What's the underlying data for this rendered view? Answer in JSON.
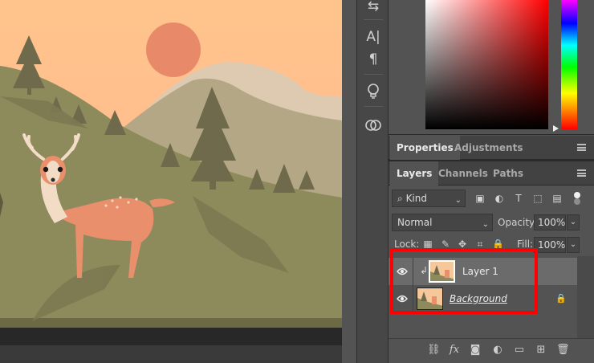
{
  "tools": {
    "items": [
      {
        "name": "character-tool-icon",
        "glyph": "A|"
      },
      {
        "name": "paragraph-tool-icon",
        "glyph": "¶"
      },
      {
        "name": "lightbulb-icon",
        "glyph": "💡"
      },
      {
        "name": "cloud-libraries-icon",
        "glyph": "☁"
      }
    ]
  },
  "properties_tabs": {
    "properties": "Properties",
    "adjustments": "Adjustments"
  },
  "layers_tabs": {
    "layers": "Layers",
    "channels": "Channels",
    "paths": "Paths"
  },
  "filter": {
    "kind_label": "Kind"
  },
  "blend": {
    "mode": "Normal",
    "opacity_label": "Opacity:",
    "opacity_value": "100%"
  },
  "lock": {
    "label": "Lock:",
    "fill_label": "Fill:",
    "fill_value": "100%"
  },
  "layers": [
    {
      "name": "Layer 1",
      "selected": true,
      "clipped": true,
      "locked": false,
      "italic": false
    },
    {
      "name": "Background",
      "selected": false,
      "clipped": false,
      "locked": true,
      "italic": true
    }
  ],
  "colors": {
    "highlight": "#ff0000",
    "panel_bg": "#535353",
    "sky_top": "#ffc38a",
    "sun": "#e88a6a",
    "hill": "#8d8a5c",
    "mountain": "#b4a884",
    "deer": "#ea8f6c"
  }
}
